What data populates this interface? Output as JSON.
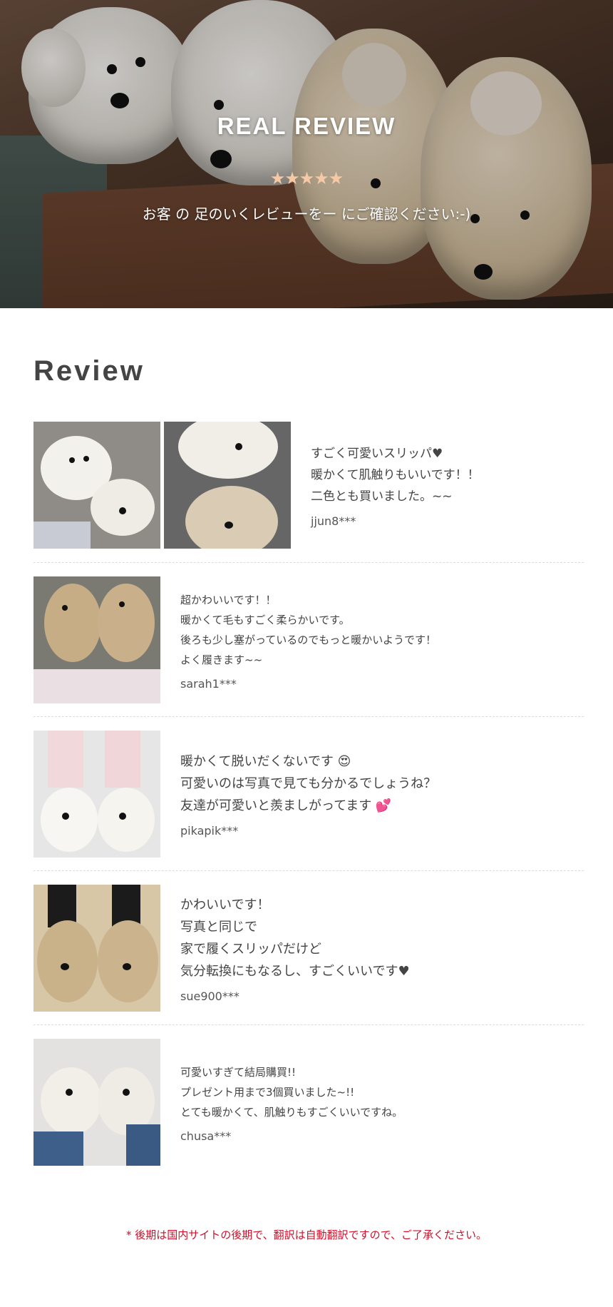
{
  "hero": {
    "title": "REAL REVIEW",
    "stars": "★★★★★",
    "subtitle": "お客 の 足のいくレビューをー にご確認ください:-)"
  },
  "section": {
    "heading": "Review"
  },
  "reviews": [
    {
      "body": "すごく可愛いスリッパ♥\n暖かくて肌触りもいいです！！\n二色とも買いました。~~",
      "user": "jjun8***"
    },
    {
      "body": "超かわいいです！！\n暖かくて毛もすごく柔らかいです。\n後ろも少し塞がっているのでもっと暖かいようです！\nよく履きます~~",
      "user": "sarah1***"
    },
    {
      "body": "暖かくて脱いだくないです 😍\n可愛いのは写真で見ても分かるでしょうね？\n友達が可愛いと羨ましがってます 💕",
      "user": "pikapik***"
    },
    {
      "body": "かわいいです！\n写真と同じで\n家で履くスリッパだけど\n気分転換にもなるし、すごくいいです♥",
      "user": "sue900***"
    },
    {
      "body": "可愛いすぎて結局購買!!\nプレゼント用まで3個買いました~!!\nとても暖かくて、肌触りもすごくいいですね。",
      "user": "chusa***"
    }
  ],
  "footer": {
    "note": "* 後期は国内サイトの後期で、翻訳は自動翻訳ですので、ご了承ください。"
  }
}
